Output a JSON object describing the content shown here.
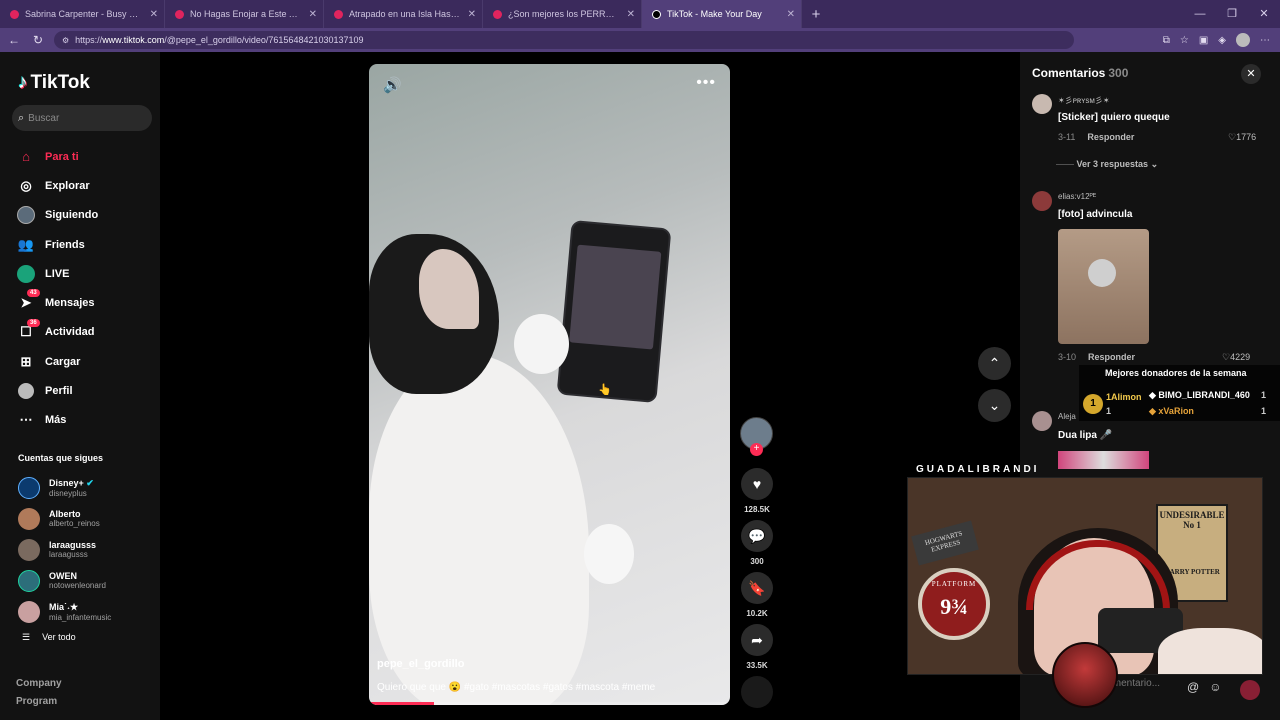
{
  "browser": {
    "tabs": [
      {
        "title": "Sabrina Carpenter - Busy Woman",
        "active": false
      },
      {
        "title": "No Hagas Enojar a Este Artista - Y",
        "active": false
      },
      {
        "title": "Atrapado en una Isla Hasta que G",
        "active": false
      },
      {
        "title": "¿Son mejores los PERROS o GATO",
        "active": false
      },
      {
        "title": "TikTok - Make Your Day",
        "active": true
      }
    ],
    "url_prefix": "https://",
    "url_host": "www.tiktok.com",
    "url_path": "/@pepe_el_gordillo/video/7615648421030137109"
  },
  "sidebar": {
    "logo": "TikTok",
    "search_placeholder": "Buscar",
    "nav": [
      {
        "label": "Para ti",
        "icon": "home-icon",
        "active": true,
        "badge": ""
      },
      {
        "label": "Explorar",
        "icon": "compass-icon",
        "active": false,
        "badge": ""
      },
      {
        "label": "Siguiendo",
        "icon": "following-icon",
        "active": false,
        "badge": ""
      },
      {
        "label": "Friends",
        "icon": "friends-icon",
        "active": false,
        "badge": ""
      },
      {
        "label": "LIVE",
        "icon": "live-icon",
        "active": false,
        "badge": ""
      },
      {
        "label": "Mensajes",
        "icon": "messages-icon",
        "active": false,
        "badge": "43"
      },
      {
        "label": "Actividad",
        "icon": "activity-icon",
        "active": false,
        "badge": "36"
      },
      {
        "label": "Cargar",
        "icon": "upload-icon",
        "active": false,
        "badge": ""
      },
      {
        "label": "Perfil",
        "icon": "profile-icon",
        "active": false,
        "badge": ""
      },
      {
        "label": "Más",
        "icon": "more-icon",
        "active": false,
        "badge": ""
      }
    ],
    "following_title": "Cuentas que sigues",
    "following": [
      {
        "name": "Disney+",
        "user": "disneyplus",
        "verified": true,
        "color": "#0b3a6e"
      },
      {
        "name": "Alberto",
        "user": "alberto_reinos",
        "verified": false,
        "color": "#b07a5a"
      },
      {
        "name": "laraagusss",
        "user": "laraagusss",
        "verified": false,
        "color": "#7a6a5f"
      },
      {
        "name": "OWEN",
        "user": "notowenleonard",
        "verified": false,
        "color": "#2c6e7a"
      },
      {
        "name": "Mia˙˖★",
        "user": "mia_infantemusic",
        "verified": false,
        "color": "#c9a0a0"
      }
    ],
    "see_all": "Ver todo",
    "footer": [
      "Company",
      "Program"
    ]
  },
  "video": {
    "author": "pepe_el_gordillo",
    "caption": "Quiero que que 😮 #gato #mascotas #gatos #mascota #meme",
    "progress": 0.18
  },
  "actions": {
    "likes": "128.5K",
    "comments": "300",
    "saves": "10.2K",
    "shares": "33.5K"
  },
  "comments": {
    "title": "Comentarios",
    "count": "300",
    "items": [
      {
        "user": "✶彡ᴘʀʏsᴍ彡✶",
        "text": "[Sticker] quiero queque",
        "date": "3-11",
        "reply": "Responder",
        "likes": "1776",
        "replies": "Ver 3 respuestas"
      },
      {
        "user": "elias:v12ᴾᴱ",
        "text": "[foto] advincula",
        "date": "3-10",
        "reply": "Responder",
        "likes": "4229"
      },
      {
        "user": "Aleja",
        "text": "Dua lipa 🎤"
      }
    ],
    "input_placeholder": "Comentario..."
  },
  "overlay": {
    "donors_title": "Mejores donadores de la semana",
    "donors": [
      {
        "rank": "1",
        "name": "1Alimon",
        "count": "1"
      },
      {
        "rank": "",
        "name": "BIMO_LIBRANDI_460",
        "count": "1"
      },
      {
        "rank": "",
        "name": "xVaRion",
        "count": "1"
      }
    ],
    "camera_label": "GUADALIBRANDI",
    "poster_title": "UNDESIRABLE",
    "poster_number": "No 1",
    "poster_name": "HARRY POTTER",
    "sign_text": "HOGWARTS EXPRESS",
    "platform_label": "PLATFORM",
    "platform_number": "9¾"
  }
}
